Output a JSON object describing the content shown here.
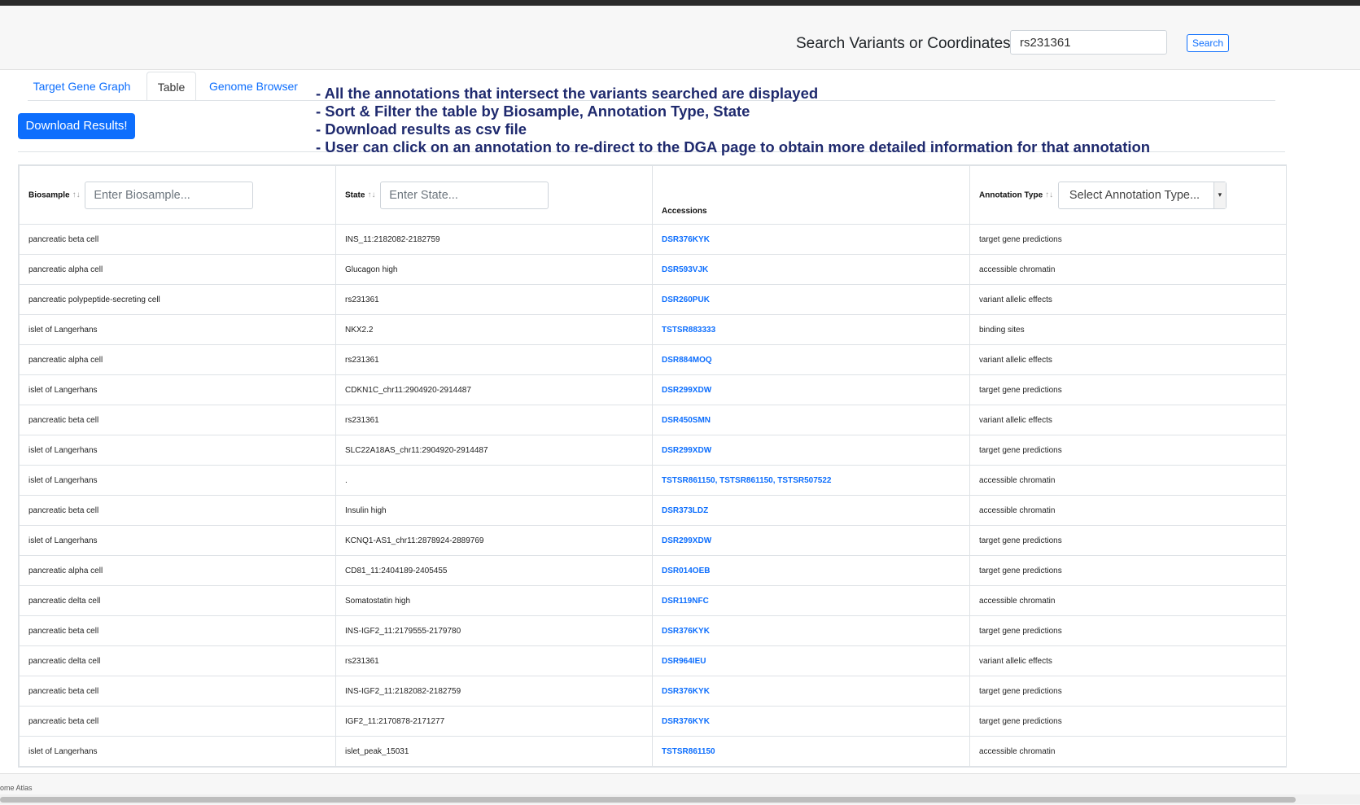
{
  "header": {
    "search_label": "Search Variants or Coordinates",
    "search_value": "rs231361",
    "search_button": "Search"
  },
  "tabs": [
    {
      "label": "Target Gene Graph",
      "active": false
    },
    {
      "label": "Table",
      "active": true
    },
    {
      "label": "Genome Browser",
      "active": false
    }
  ],
  "download_button": "Download Results!",
  "notes": [
    "-  All the annotations that intersect the variants searched are displayed",
    "- Sort & Filter the table by Biosample, Annotation Type, State",
    "- Download results as csv file",
    "- User can click on an annotation to re-direct to the DGA page to obtain more detailed information for that annotation"
  ],
  "table": {
    "columns": {
      "biosample": "Biosample",
      "state": "State",
      "accessions": "Accessions",
      "annotation_type": "Annotation Type"
    },
    "filters": {
      "biosample_placeholder": "Enter Biosample...",
      "state_placeholder": "Enter State...",
      "annotation_type_placeholder": "Select Annotation Type..."
    },
    "sort_arrows": "↑↓",
    "rows": [
      {
        "biosample": "pancreatic beta cell",
        "state": "INS_11:2182082-2182759",
        "accessions": "DSR376KYK",
        "annotation_type": "target gene predictions"
      },
      {
        "biosample": "pancreatic alpha cell",
        "state": "Glucagon high",
        "accessions": "DSR593VJK",
        "annotation_type": "accessible chromatin"
      },
      {
        "biosample": "pancreatic polypeptide-secreting cell",
        "state": "rs231361",
        "accessions": "DSR260PUK",
        "annotation_type": "variant allelic effects"
      },
      {
        "biosample": "islet of Langerhans",
        "state": "NKX2.2",
        "accessions": "TSTSR883333",
        "annotation_type": "binding sites"
      },
      {
        "biosample": "pancreatic alpha cell",
        "state": "rs231361",
        "accessions": "DSR884MOQ",
        "annotation_type": "variant allelic effects"
      },
      {
        "biosample": "islet of Langerhans",
        "state": "CDKN1C_chr11:2904920-2914487",
        "accessions": "DSR299XDW",
        "annotation_type": "target gene predictions"
      },
      {
        "biosample": "pancreatic beta cell",
        "state": "rs231361",
        "accessions": "DSR450SMN",
        "annotation_type": "variant allelic effects"
      },
      {
        "biosample": "islet of Langerhans",
        "state": "SLC22A18AS_chr11:2904920-2914487",
        "accessions": "DSR299XDW",
        "annotation_type": "target gene predictions"
      },
      {
        "biosample": "islet of Langerhans",
        "state": ".",
        "accessions": "TSTSR861150, TSTSR861150, TSTSR507522",
        "annotation_type": "accessible chromatin"
      },
      {
        "biosample": "pancreatic beta cell",
        "state": "Insulin high",
        "accessions": "DSR373LDZ",
        "annotation_type": "accessible chromatin"
      },
      {
        "biosample": "islet of Langerhans",
        "state": "KCNQ1-AS1_chr11:2878924-2889769",
        "accessions": "DSR299XDW",
        "annotation_type": "target gene predictions"
      },
      {
        "biosample": "pancreatic alpha cell",
        "state": "CD81_11:2404189-2405455",
        "accessions": "DSR014OEB",
        "annotation_type": "target gene predictions"
      },
      {
        "biosample": "pancreatic delta cell",
        "state": "Somatostatin high",
        "accessions": "DSR119NFC",
        "annotation_type": "accessible chromatin"
      },
      {
        "biosample": "pancreatic beta cell",
        "state": "INS-IGF2_11:2179555-2179780",
        "accessions": "DSR376KYK",
        "annotation_type": "target gene predictions"
      },
      {
        "biosample": "pancreatic delta cell",
        "state": "rs231361",
        "accessions": "DSR964IEU",
        "annotation_type": "variant allelic effects"
      },
      {
        "biosample": "pancreatic beta cell",
        "state": "INS-IGF2_11:2182082-2182759",
        "accessions": "DSR376KYK",
        "annotation_type": "target gene predictions"
      },
      {
        "biosample": "pancreatic beta cell",
        "state": "IGF2_11:2170878-2171277",
        "accessions": "DSR376KYK",
        "annotation_type": "target gene predictions"
      },
      {
        "biosample": "islet of Langerhans",
        "state": "islet_peak_15031",
        "accessions": "TSTSR861150",
        "annotation_type": "accessible chromatin"
      }
    ]
  },
  "footer_text": "ome Atlas"
}
